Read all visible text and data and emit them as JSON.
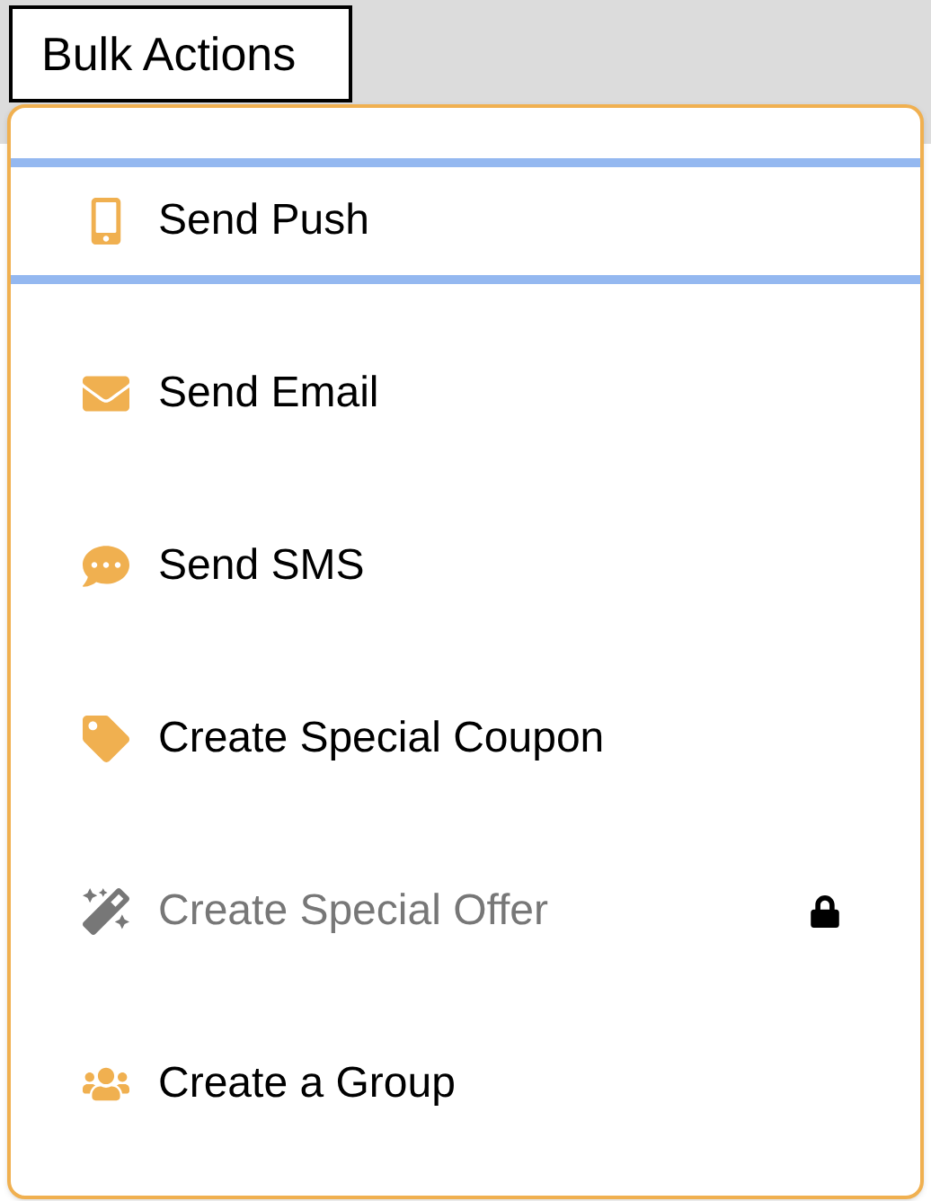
{
  "button": {
    "label": "Bulk Actions"
  },
  "menu": {
    "items": [
      {
        "kind": "push",
        "label": "Send Push",
        "selected": true,
        "disabled": false
      },
      {
        "kind": "email",
        "label": "Send Email",
        "selected": false,
        "disabled": false
      },
      {
        "kind": "sms",
        "label": "Send SMS",
        "selected": false,
        "disabled": false
      },
      {
        "kind": "coupon",
        "label": "Create Special Coupon",
        "selected": false,
        "disabled": false
      },
      {
        "kind": "offer",
        "label": "Create Special Offer",
        "selected": false,
        "disabled": true
      },
      {
        "kind": "group",
        "label": "Create a Group",
        "selected": false,
        "disabled": false
      }
    ]
  }
}
